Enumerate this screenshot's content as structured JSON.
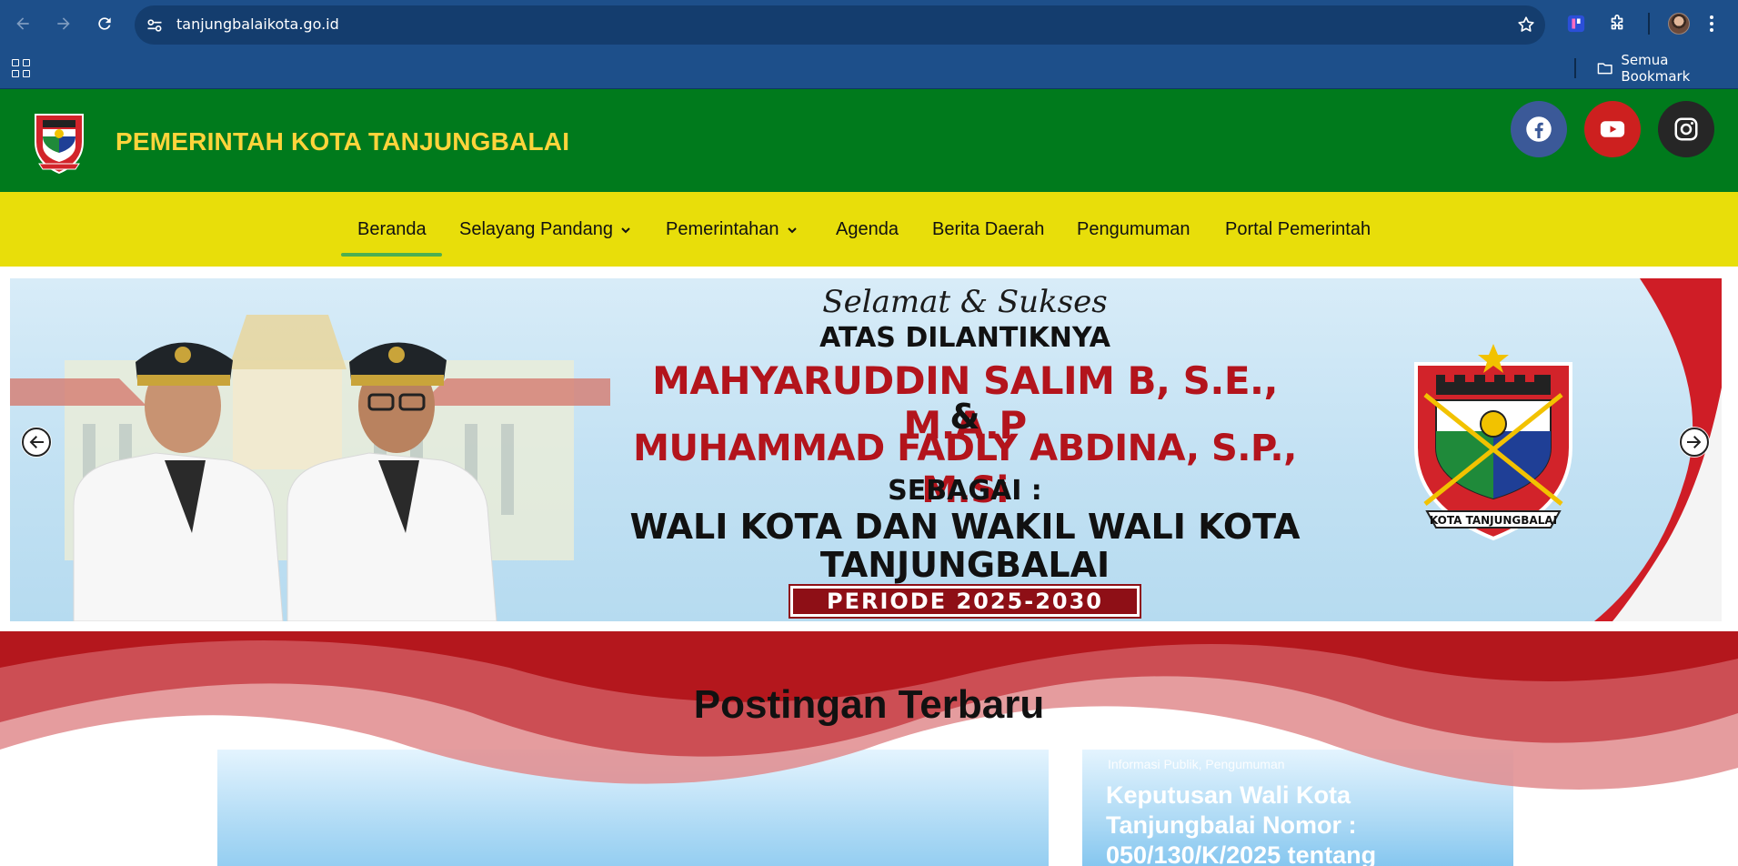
{
  "browser": {
    "url": "tanjungbalaikota.go.id",
    "bookmarks_label": "Semua Bookmark"
  },
  "site": {
    "title": "PEMERINTAH KOTA TANJUNGBALAI",
    "colors": {
      "header": "#007a1c",
      "nav": "#e8de0a",
      "title": "#ffd43b",
      "accent": "#4caf50"
    },
    "social": [
      {
        "name": "facebook",
        "icon": "facebook-icon",
        "color": "#3b5998"
      },
      {
        "name": "youtube",
        "icon": "youtube-icon",
        "color": "#cd201f"
      },
      {
        "name": "instagram",
        "icon": "instagram-icon",
        "color": "#262626"
      }
    ]
  },
  "nav": {
    "items": [
      {
        "label": "Beranda",
        "active": true
      },
      {
        "label": "Selayang Pandang",
        "dropdown": true
      },
      {
        "label": "Pemerintahan",
        "dropdown": true
      },
      {
        "label": "Agenda"
      },
      {
        "label": "Berita Daerah"
      },
      {
        "label": "Pengumuman"
      },
      {
        "label": "Portal Pemerintah"
      }
    ]
  },
  "banner": {
    "greeting": "Selamat & Sukses",
    "line1": "ATAS DILANTIKNYA",
    "name1": "MAHYARUDDIN SALIM B, S.E., M.A.P",
    "ampersand": "&",
    "name2": "MUHAMMAD FADLY ABDINA, S.P., M.Si",
    "sebagai": "SEBAGAI :",
    "role_line1": "WALI KOTA DAN WAKIL WALI KOTA",
    "role_line2": "TANJUNGBALAI",
    "period": "PERIODE 2025-2030",
    "emblem_text": "KOTA TANJUNGBALAI"
  },
  "posts": {
    "heading": "Postingan Terbaru",
    "featured": {
      "categories": "Informasi Publik, Pengumuman",
      "title": "Keputusan Wali Kota Tanjungbalai Nomor : 050/130/K/2025 tentang"
    }
  }
}
